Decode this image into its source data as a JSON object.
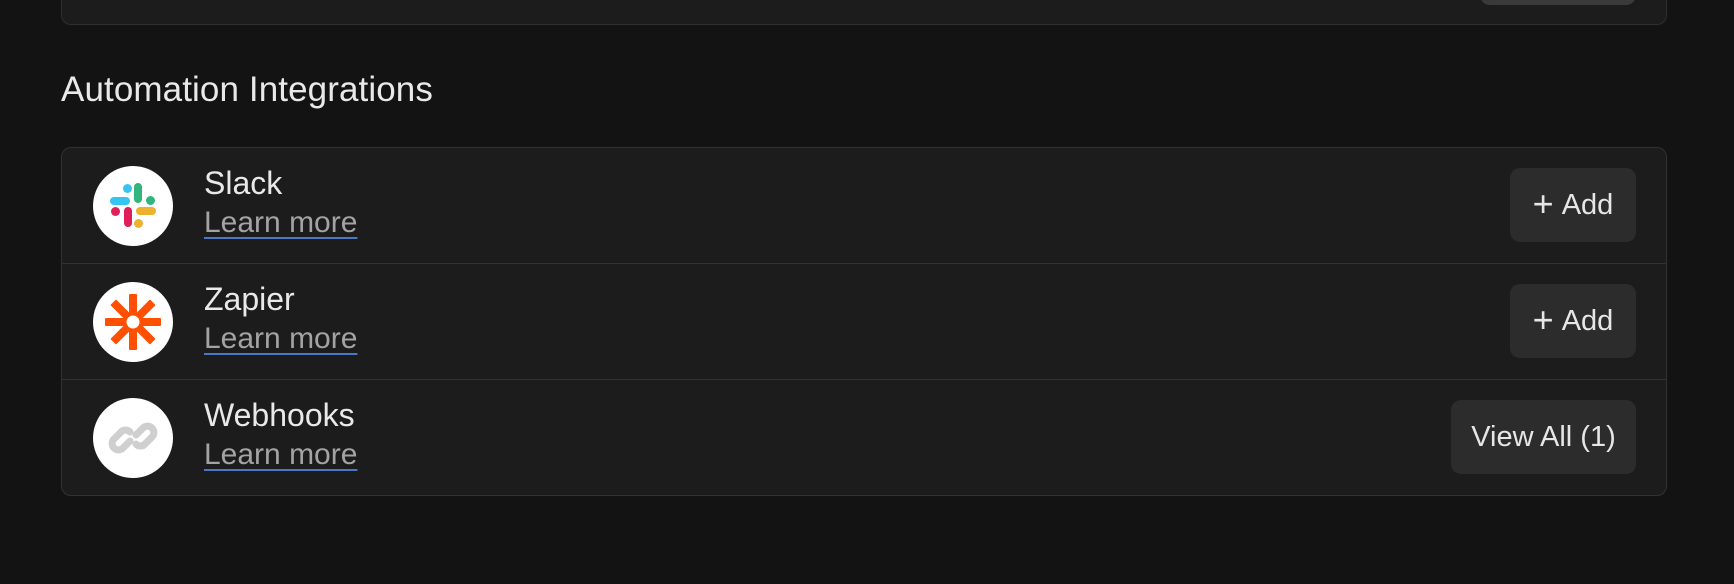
{
  "section": {
    "title": "Automation Integrations"
  },
  "integrations": [
    {
      "name": "Slack",
      "link_label": "Learn more",
      "action_icon": "+",
      "action_label": "Add",
      "logo": "slack-logo"
    },
    {
      "name": "Zapier",
      "link_label": "Learn more",
      "action_icon": "+",
      "action_label": "Add",
      "logo": "zapier-logo"
    },
    {
      "name": "Webhooks",
      "link_label": "Learn more",
      "action_label": "View All (1)",
      "logo": "link-icon"
    }
  ],
  "colors": {
    "background": "#131313",
    "card": "#1c1c1c",
    "border": "#323232",
    "button": "#2c2c2c",
    "link_underline": "#4a79c4",
    "zapier_orange": "#ff4f00",
    "slack_blue": "#36c5f0",
    "slack_green": "#2eb67d",
    "slack_red": "#e01e5a",
    "slack_yellow": "#ecb22e"
  }
}
